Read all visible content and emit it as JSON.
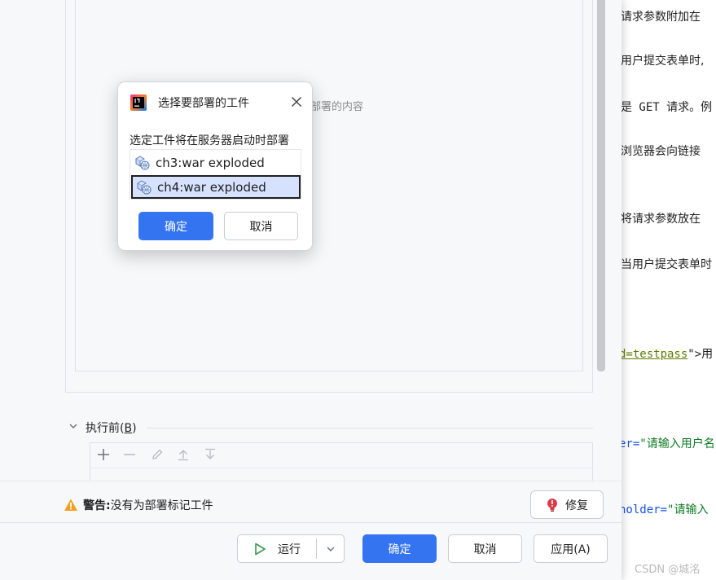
{
  "editor": {
    "lines": [
      {
        "segments": [
          {
            "text": "请求参数附加在",
            "cls": "c-plain"
          }
        ]
      },
      {
        "segments": [
          {
            "text": "用户提交表单时,",
            "cls": "c-plain"
          }
        ]
      },
      {
        "segments": [
          {
            "text": "是 GET 请求。例",
            "cls": "c-plain"
          }
        ]
      },
      {
        "segments": [
          {
            "text": "浏览器会向链接",
            "cls": "c-plain"
          }
        ]
      },
      {
        "segments": [
          {
            "text": "将请求参数放在",
            "cls": "c-plain"
          }
        ]
      },
      {
        "segments": [
          {
            "text": "当用户提交表单时",
            "cls": "c-plain"
          }
        ]
      },
      {
        "segments": [
          {
            "text": "d=testpass",
            "cls": "c-olive"
          },
          {
            "text": "\">",
            "cls": "c-plain"
          },
          {
            "text": "用",
            "cls": "c-plain"
          }
        ]
      },
      {
        "segments": [
          {
            "text": "er=",
            "cls": "c-blue"
          },
          {
            "text": "\"请输入用户名",
            "cls": "c-green"
          }
        ]
      },
      {
        "segments": [
          {
            "text": "holder=",
            "cls": "c-blue"
          },
          {
            "text": "\"请输入",
            "cls": "c-green"
          }
        ]
      }
    ],
    "watermark": "CSDN @城洺"
  },
  "main_dialog": {
    "empty_hint": "要部署的内容",
    "before_launch": {
      "title": "执行前(",
      "mnemonic": "B",
      "title_end": ")"
    },
    "warning": {
      "label": "警告:",
      "text": " 没有为部署标记工件"
    },
    "fix_button": "修复",
    "footer": {
      "run": "运行",
      "ok": "确定",
      "cancel": "取消",
      "apply": "应用(A)"
    }
  },
  "popup": {
    "title": "选择要部署的工件",
    "description": "选定工件将在服务器启动时部署",
    "artifacts": [
      {
        "label": "ch3:war exploded",
        "selected": false
      },
      {
        "label": "ch4:war exploded",
        "selected": true
      }
    ],
    "ok": "确定",
    "cancel": "取消"
  },
  "colors": {
    "accent": "#3574f0",
    "selection": "#d5e1fd",
    "warning": "#f2a01f",
    "error": "#db3b4b"
  },
  "icons": [
    "intellij-logo-icon",
    "close-icon",
    "artifact-icon",
    "add-icon",
    "remove-icon",
    "edit-icon",
    "move-up-icon",
    "move-down-icon",
    "warning-icon",
    "lightbulb-error-icon",
    "play-icon",
    "chevron-down-icon"
  ]
}
